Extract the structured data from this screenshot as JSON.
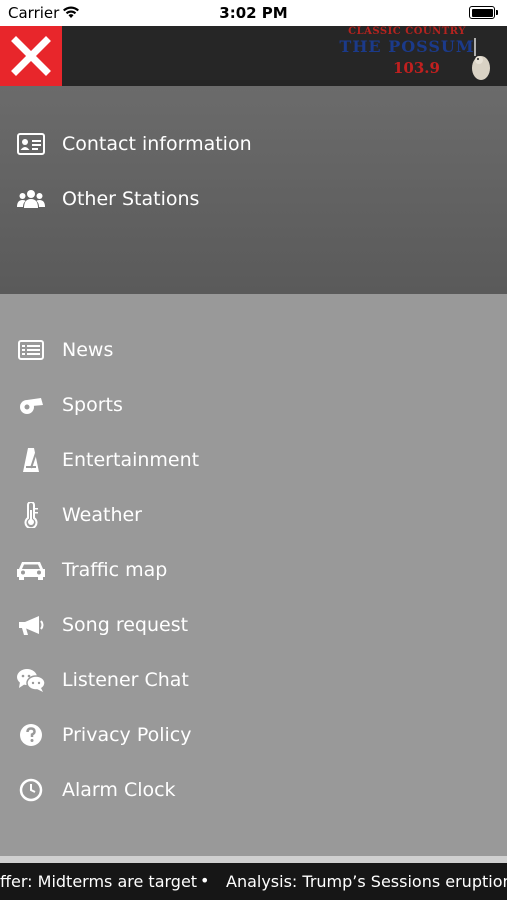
{
  "status_bar": {
    "carrier": "Carrier",
    "time": "3:02 PM"
  },
  "header": {
    "close_icon": "close-icon",
    "logo": {
      "line1": "CLASSIC COUNTRY",
      "line2": "THE POSSUM",
      "line3": "103.9"
    }
  },
  "menu_top": [
    {
      "label": "Contact information",
      "icon": "contact-card-icon"
    },
    {
      "label": "Other Stations",
      "icon": "users-icon"
    }
  ],
  "menu_main": [
    {
      "label": "News",
      "icon": "newspaper-icon"
    },
    {
      "label": "Sports",
      "icon": "whistle-icon"
    },
    {
      "label": "Entertainment",
      "icon": "metronome-icon"
    },
    {
      "label": "Weather",
      "icon": "thermometer-icon"
    },
    {
      "label": "Traffic map",
      "icon": "car-icon"
    },
    {
      "label": "Song request",
      "icon": "megaphone-icon"
    },
    {
      "label": "Listener Chat",
      "icon": "chat-icon"
    },
    {
      "label": "Privacy Policy",
      "icon": "question-icon"
    },
    {
      "label": "Alarm Clock",
      "icon": "clock-icon"
    }
  ],
  "ticker": {
    "item1": "ffer: Midterms are target",
    "separator": "•",
    "item2": "Analysis: Trump’s Sessions eruption"
  },
  "colors": {
    "close_bg": "#e8262b",
    "top_bar_bg": "#262626",
    "section_top_bg": "#626262",
    "section_main_bg": "#999999",
    "ticker_bg": "#161616"
  }
}
